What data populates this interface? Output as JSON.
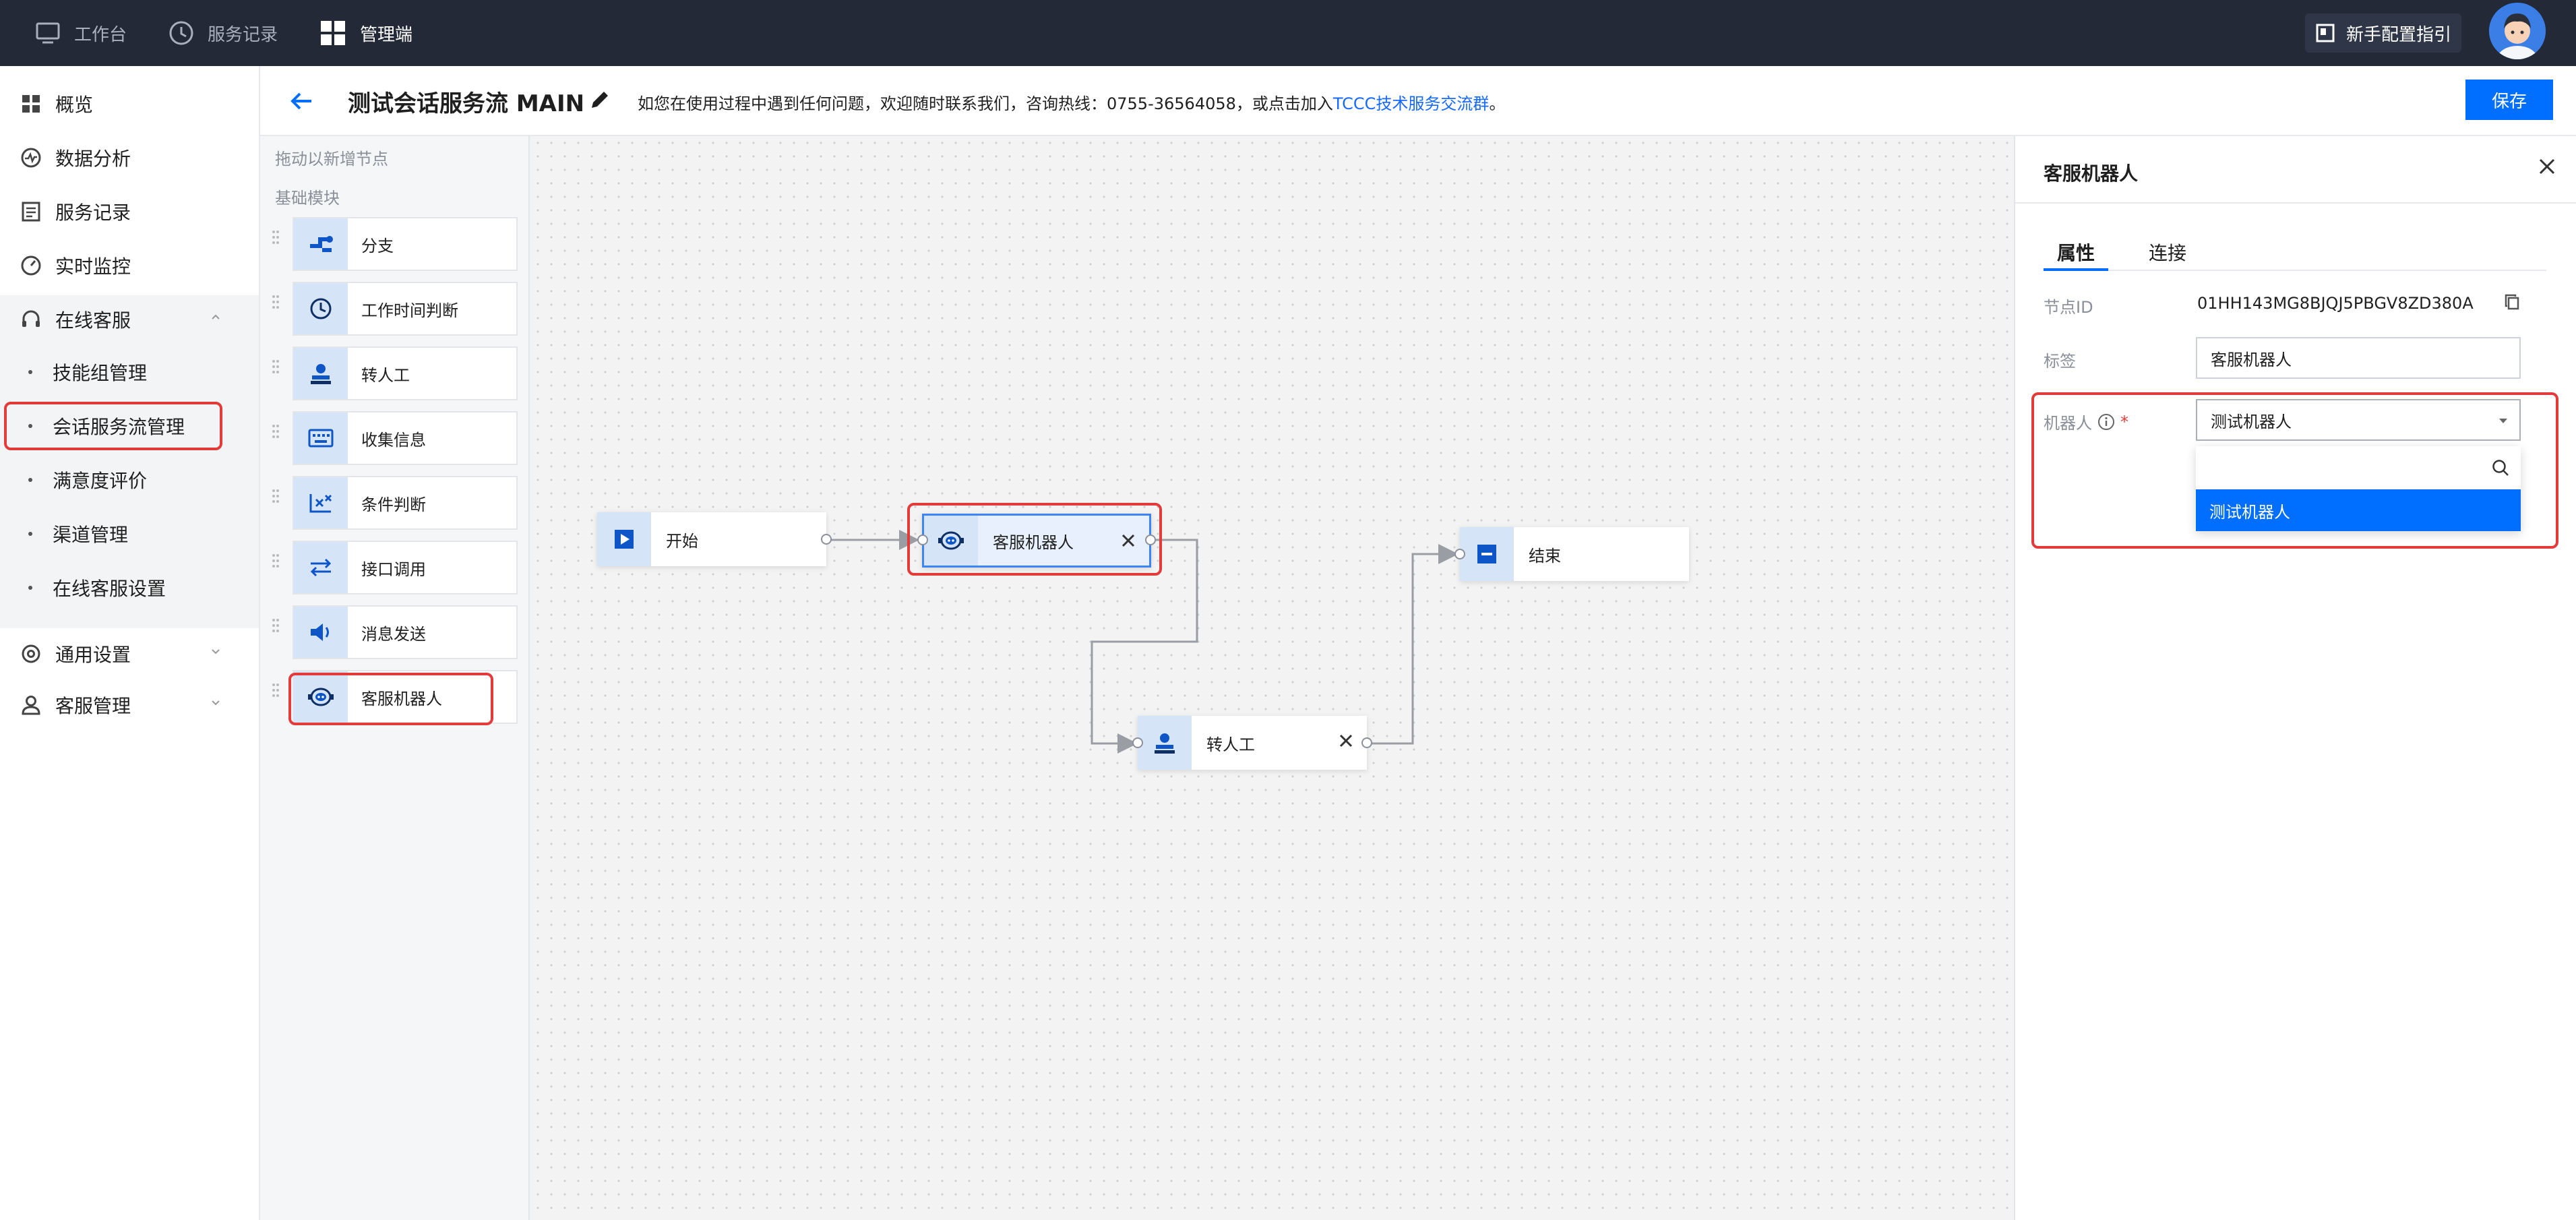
{
  "topnav": {
    "items": [
      {
        "label": "工作台",
        "icon": "monitor-icon",
        "active": false
      },
      {
        "label": "服务记录",
        "icon": "clock-icon",
        "active": false
      },
      {
        "label": "管理端",
        "icon": "grid-icon",
        "active": true
      }
    ],
    "guide_label": "新手配置指引"
  },
  "sidebar": {
    "items": [
      {
        "label": "概览",
        "icon": "dashboard-icon"
      },
      {
        "label": "数据分析",
        "icon": "analytics-icon"
      },
      {
        "label": "服务记录",
        "icon": "records-icon"
      },
      {
        "label": "实时监控",
        "icon": "monitor-gauge-icon"
      },
      {
        "label": "在线客服",
        "icon": "headset-icon",
        "expanded": true
      },
      {
        "label": "通用设置",
        "icon": "settings-icon"
      },
      {
        "label": "客服管理",
        "icon": "user-icon"
      }
    ],
    "subitems": [
      {
        "label": "技能组管理"
      },
      {
        "label": "会话服务流管理",
        "highlighted": true
      },
      {
        "label": "满意度评价"
      },
      {
        "label": "渠道管理"
      },
      {
        "label": "在线客服设置"
      }
    ]
  },
  "header": {
    "title": "测试会话服务流 MAIN",
    "notice_text": "如您在使用过程中遇到任何问题，欢迎随时联系我们，咨询热线：0755-36564058，或点击加入",
    "notice_link": "TCCC技术服务交流群",
    "notice_end": "。",
    "save_label": "保存"
  },
  "module_panel": {
    "hint": "拖动以新增节点",
    "section": "基础模块",
    "modules": [
      {
        "label": "分支",
        "icon": "branch-icon"
      },
      {
        "label": "工作时间判断",
        "icon": "clock-icon"
      },
      {
        "label": "转人工",
        "icon": "agent-icon"
      },
      {
        "label": "收集信息",
        "icon": "keyboard-icon"
      },
      {
        "label": "条件判断",
        "icon": "condition-icon"
      },
      {
        "label": "接口调用",
        "icon": "api-swap-icon"
      },
      {
        "label": "消息发送",
        "icon": "speaker-icon"
      },
      {
        "label": "客服机器人",
        "icon": "robot-icon",
        "highlighted": true
      }
    ]
  },
  "canvas": {
    "nodes": {
      "start": {
        "label": "开始",
        "icon": "play-icon"
      },
      "robot": {
        "label": "客服机器人",
        "icon": "robot-icon",
        "selected": true
      },
      "agent": {
        "label": "转人工",
        "icon": "agent-icon"
      },
      "end": {
        "label": "结束",
        "icon": "stop-icon"
      }
    }
  },
  "props": {
    "title": "客服机器人",
    "tabs": [
      {
        "label": "属性",
        "active": true
      },
      {
        "label": "连接",
        "active": false
      }
    ],
    "node_id_label": "节点ID",
    "node_id_value": "01HH143MG8BJQJ5PBGV8ZD380A",
    "tag_label": "标签",
    "tag_value": "客服机器人",
    "robot_label": "机器人",
    "robot_required": "*",
    "robot_value": "测试机器人",
    "dropdown_options": [
      "测试机器人"
    ]
  },
  "colors": {
    "primary": "#006eff",
    "highlight_border": "#e33a3a",
    "topbar": "#232936"
  }
}
